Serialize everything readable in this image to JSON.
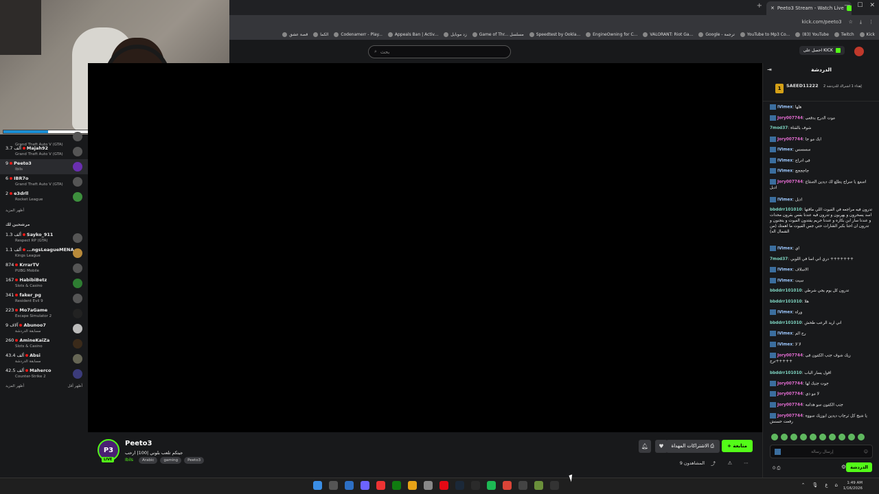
{
  "browser": {
    "tab_title": "Peeto3 Stream - Watch Live",
    "url": "kick.com/peeto3",
    "bookmarks": [
      "Kick",
      "Twitch",
      "(83) YouTube",
      "YouTube to Mp3 Co...",
      "Google - ترجمة",
      "VALORANT: Riot Ga...",
      "EngineOwning for C...",
      "Speedtest by Ookla...",
      "Game of Thr... مسلسل",
      "زد موبايل",
      "Appeals Ban | Activ...",
      "Codenamerr - Play...",
      "الكما",
      "قصة عشق"
    ]
  },
  "header": {
    "search_placeholder": "بحث",
    "get_kick_label": "احصل على KICK"
  },
  "webcam": {
    "progress_fraction": 0.2,
    "progress_left": "0m",
    "progress_right": "1hrs"
  },
  "sidebar": {
    "channels_top": [
      {
        "viewers": "",
        "name": "",
        "game": "Grand Theft Auto V (GTA)"
      },
      {
        "viewers": "3.7 ألف",
        "name": "Majah92",
        "game": "Grand Theft Auto V (GTA)"
      },
      {
        "viewers": "9",
        "name": "Peeto3",
        "game": "Ibils"
      },
      {
        "viewers": "6",
        "name": "IBR7o",
        "game": "Grand Theft Auto V (GTA)"
      },
      {
        "viewers": "2",
        "name": "e3drll",
        "game": "Rocket League"
      }
    ],
    "show_more_1": "أظهر المزيد",
    "recommended_title": "مرشحين لك",
    "channels_rec": [
      {
        "viewers": "1.3 ألف",
        "name": "Sayko_911",
        "game": "Respect RP (GTA)"
      },
      {
        "viewers": "1.1 ألف",
        "name": "...ngsLeagueMENA",
        "game": "Kings League"
      },
      {
        "viewers": "874",
        "name": "KrrarTV",
        "game": "PUBG Mobile"
      },
      {
        "viewers": "167",
        "name": "HabibiBetz",
        "game": "Slots & Casino"
      },
      {
        "viewers": "341",
        "name": "faker_pg",
        "game": "Resident Evil 9"
      },
      {
        "viewers": "223",
        "name": "Mo7aGame",
        "game": "Escape Simulator 2"
      },
      {
        "viewers": "9 آلاف",
        "name": "Abunoo7",
        "game": "مسابقة الدردشة"
      },
      {
        "viewers": "260",
        "name": "AmineKaiZa",
        "game": "Slots & Casino"
      },
      {
        "viewers": "43.4 ألف",
        "name": "Absi",
        "game": "مسابقة الدردشة"
      },
      {
        "viewers": "42.5 ألف",
        "name": "Maherco",
        "game": "Counter-Strike 2"
      }
    ],
    "show_more_2": "أظهر المزيد",
    "show_less": "أظهر أقل"
  },
  "stream": {
    "avatar_text": "P3",
    "live_badge": "LIVE",
    "streamer": "Peeto3",
    "title": "جيتكم تلعب بلوني |100| ارحب",
    "category": "Ibils",
    "tags": [
      "Arabic",
      "gaming",
      "Peeto3"
    ],
    "follow_label": "متابعة",
    "subscribe_label": "الاشتراكات المهداة",
    "viewers": "9 المشاهدون"
  },
  "chat": {
    "title": "الدردشة",
    "pinned_rank": "1",
    "pinned_user": "SAEED11222",
    "pinned_text": "إهداء 1 اشتراك للدردشة 2",
    "messages": [
      {
        "user": "iVimex",
        "text": "هلها"
      },
      {
        "user": "Jory007744",
        "text": "موت الدرج بدفعي"
      },
      {
        "user": "7mod37",
        "text": "شوف بالقناة"
      },
      {
        "user": "Jory007744",
        "text": "ابك مو جا"
      },
      {
        "user": "iVimex",
        "text": "سسسس"
      },
      {
        "user": "iVimex",
        "text": "في ادراج"
      },
      {
        "user": "iVimex",
        "text": "جاجججج"
      },
      {
        "user": "Jory007744",
        "text": "اسمع يا سراج يطلع لك ديدين الصقاع ادبل"
      },
      {
        "user": "iVimex",
        "text": "اذبل"
      },
      {
        "user": "bbddrr101010",
        "text": "تدرون فيه مراجعه في الفيوت اللي ماقتها اسد يسحرون و يهربون و تدرون فيه عندنا بقس بقرون محدات و عندنا سار ابن بكاره و عندنا حريم يقتدون الفيوت و يتجنون و تدرون ان احنا بكبر الشارات حتي جس الفيوت ما اهمتك (من الشمال اله)"
      },
      {
        "user": "iVimex",
        "text": "اي"
      },
      {
        "user": "7mod37",
        "text": "دري اني اسا في اللوبي +++++++"
      },
      {
        "user": "iVimex",
        "text": "الاسلاف"
      },
      {
        "user": "iVimex",
        "text": "سبت"
      },
      {
        "user": "bbddrr101010",
        "text": "تدرون كل يوم يجي شرطي"
      },
      {
        "user": "bbddrr101010",
        "text": "هلا"
      },
      {
        "user": "iVimex",
        "text": "وراه"
      },
      {
        "user": "bbddrr101010",
        "text": "اني اريد الرعب طحش"
      },
      {
        "user": "iVimex",
        "text": "رح الم"
      },
      {
        "user": "iVimex",
        "text": "لا لا"
      },
      {
        "user": "Jory007744",
        "text": "زيك شوف جنب الكفون في ترج+++++"
      },
      {
        "user": "bbddrr101010",
        "text": "اقول يسار الباب"
      },
      {
        "user": "Jory007744",
        "text": "جوت جنبك لها"
      },
      {
        "user": "Jory007744",
        "text": "لا مو ذي"
      },
      {
        "user": "Jory007744",
        "text": "جنب الكفون سو هدامه"
      },
      {
        "user": "Jory007744",
        "text": "يا شيخ كل ترجاب ديدين ابوزيك سووه رفعت حسنش"
      }
    ],
    "input_placeholder": "إرسال رسالة",
    "chat_button": "الدردشة",
    "user_count": "0"
  },
  "taskbar": {
    "time": "1:49 AM",
    "date": "1/16/2026",
    "tray_label": "ع"
  },
  "colors": {
    "kick_green": "#53fc18",
    "bg": "#18191b"
  }
}
